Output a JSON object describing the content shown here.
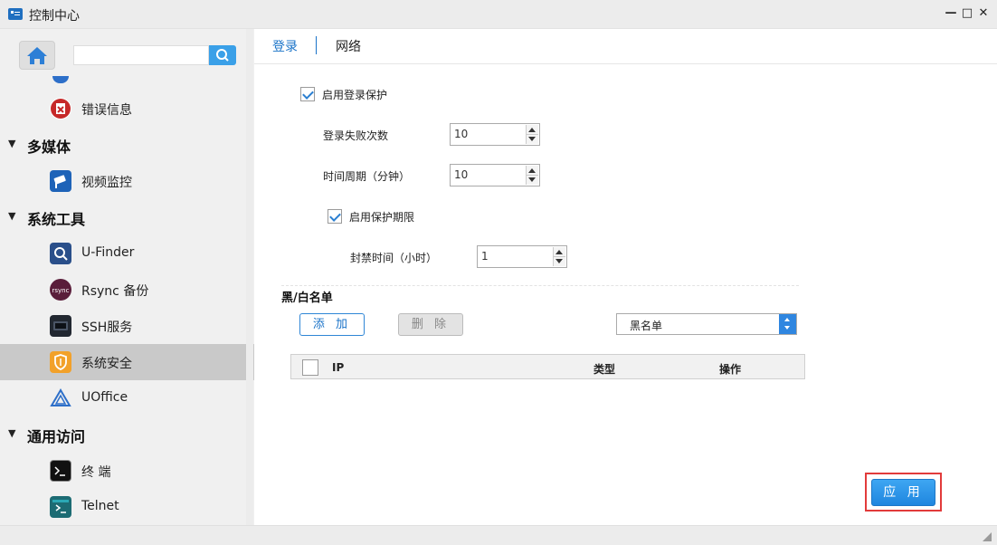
{
  "window": {
    "title": "控制中心",
    "minimize": "—",
    "maximize": "□",
    "close": "✕"
  },
  "sidebar": {
    "search_placeholder": "",
    "items": [
      {
        "label": "错误信息",
        "icon": "error-log-icon",
        "color": "#c62828"
      },
      {
        "section": "多媒体"
      },
      {
        "label": "视频监控",
        "icon": "camera-icon",
        "color": "#1e63b8"
      },
      {
        "section": "系统工具"
      },
      {
        "label": "U-Finder",
        "icon": "finder-icon",
        "color": "#2a4f8a"
      },
      {
        "label": "Rsync 备份",
        "icon": "rsync-icon",
        "color": "#5a1d3a"
      },
      {
        "label": "SSH服务",
        "icon": "ssh-icon",
        "color": "#222831"
      },
      {
        "label": "系统安全",
        "icon": "shield-icon",
        "color": "#f2a12a",
        "active": true
      },
      {
        "label": "UOffice",
        "icon": "uoffice-icon",
        "color": "#2d6fc9"
      },
      {
        "section": "通用访问"
      },
      {
        "label": "终 端",
        "icon": "terminal-icon",
        "color": "#111111"
      },
      {
        "label": "Telnet",
        "icon": "telnet-icon",
        "color": "#1c6b73"
      }
    ]
  },
  "tabs": {
    "login": "登录",
    "network": "网络"
  },
  "login_protection": {
    "enable_label": "启用登录保护",
    "enabled": true,
    "fail_count_label": "登录失败次数",
    "fail_count": "10",
    "period_label": "时间周期（分钟）",
    "period": "10",
    "limit_label": "启用保护期限",
    "limit_enabled": true,
    "ban_label": "封禁时间（小时）",
    "ban_hours": "1"
  },
  "list": {
    "title": "黑/白名单",
    "add_label": "添 加",
    "delete_label": "删 除",
    "selected": "黑名单",
    "columns": {
      "ip": "IP",
      "type": "类型",
      "action": "操作"
    }
  },
  "apply_label": "应 用",
  "colors": {
    "accent": "#1a73c8",
    "highlight": "#e23b3b"
  }
}
